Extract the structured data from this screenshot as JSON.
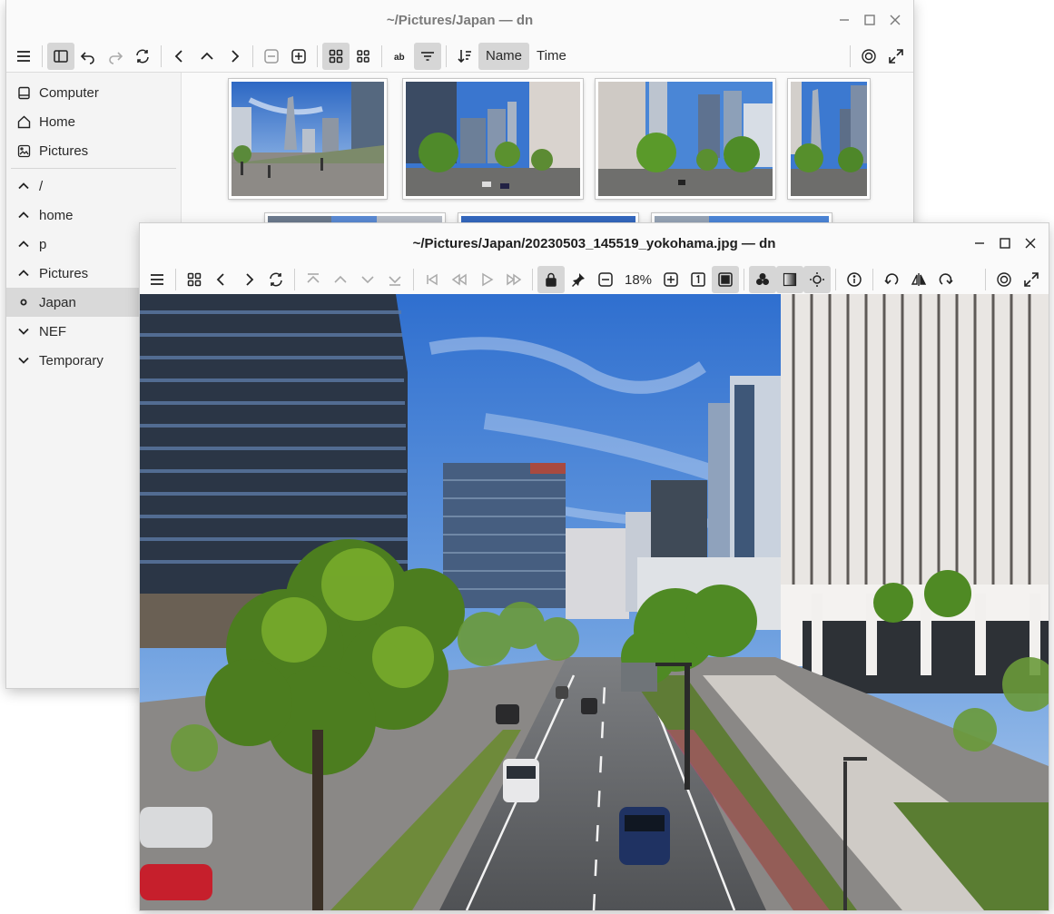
{
  "file_manager": {
    "title": "~/Pictures/Japan — dn",
    "sort_options": [
      "Name",
      "Time"
    ],
    "active_sort": "Name",
    "sidebar": {
      "places": [
        {
          "label": "Computer",
          "icon": "computer-icon"
        },
        {
          "label": "Home",
          "icon": "home-icon"
        },
        {
          "label": "Pictures",
          "icon": "pictures-icon"
        }
      ],
      "tree": [
        {
          "label": "/",
          "icon": "chevron-up-icon"
        },
        {
          "label": "home",
          "icon": "chevron-up-icon"
        },
        {
          "label": "p",
          "icon": "chevron-up-icon"
        },
        {
          "label": "Pictures",
          "icon": "chevron-up-icon"
        },
        {
          "label": "Japan",
          "icon": "circle-icon",
          "selected": true
        },
        {
          "label": "NEF",
          "icon": "chevron-down-icon"
        },
        {
          "label": "Temporary",
          "icon": "chevron-down-icon"
        }
      ]
    },
    "thumbnail_count_visible": 7
  },
  "viewer": {
    "title": "~/Pictures/Japan/20230503_145519_yokohama.jpg — dn",
    "zoom": "18%",
    "image_subject": "Yokohama street scene with high-rise buildings, trees and cars"
  },
  "colors": {
    "sky": "#3f78c9",
    "active_button": "#d6d6d6",
    "window_bg": "#fafafa"
  }
}
